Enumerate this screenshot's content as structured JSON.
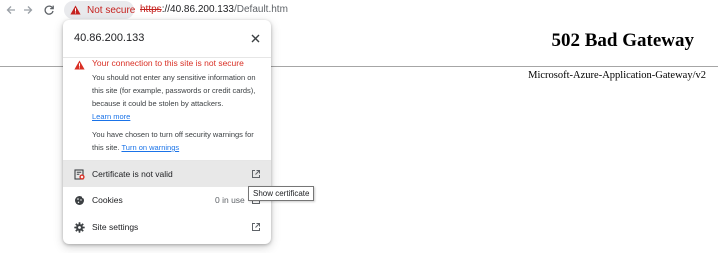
{
  "toolbar": {
    "security_chip_label": "Not secure",
    "url_scheme": "https",
    "url_host": "://40.86.200.133",
    "url_path": "/Default.htm",
    "warning_color": "#c5221f"
  },
  "page": {
    "heading": "502 Bad Gateway",
    "server_signature": "Microsoft-Azure-Application-Gateway/v2"
  },
  "popup": {
    "host": "40.86.200.133",
    "warning_title": "Your connection to this site is not secure",
    "warning_body": "You should not enter any sensitive information on this site (for example, passwords or credit cards), because it could be stolen by attackers.",
    "learn_more": "Learn more",
    "turned_off_text": "You have chosen to turn off security warnings for this site.",
    "turn_on_warnings": "Turn on warnings",
    "rows": [
      {
        "label": "Certificate is not valid",
        "icon": "certificate-icon"
      },
      {
        "label": "Cookies",
        "count": "0 in use",
        "icon": "cookie-icon"
      },
      {
        "label": "Site settings",
        "icon": "gear-icon"
      }
    ]
  },
  "tooltip": {
    "text": "Show certificate"
  }
}
